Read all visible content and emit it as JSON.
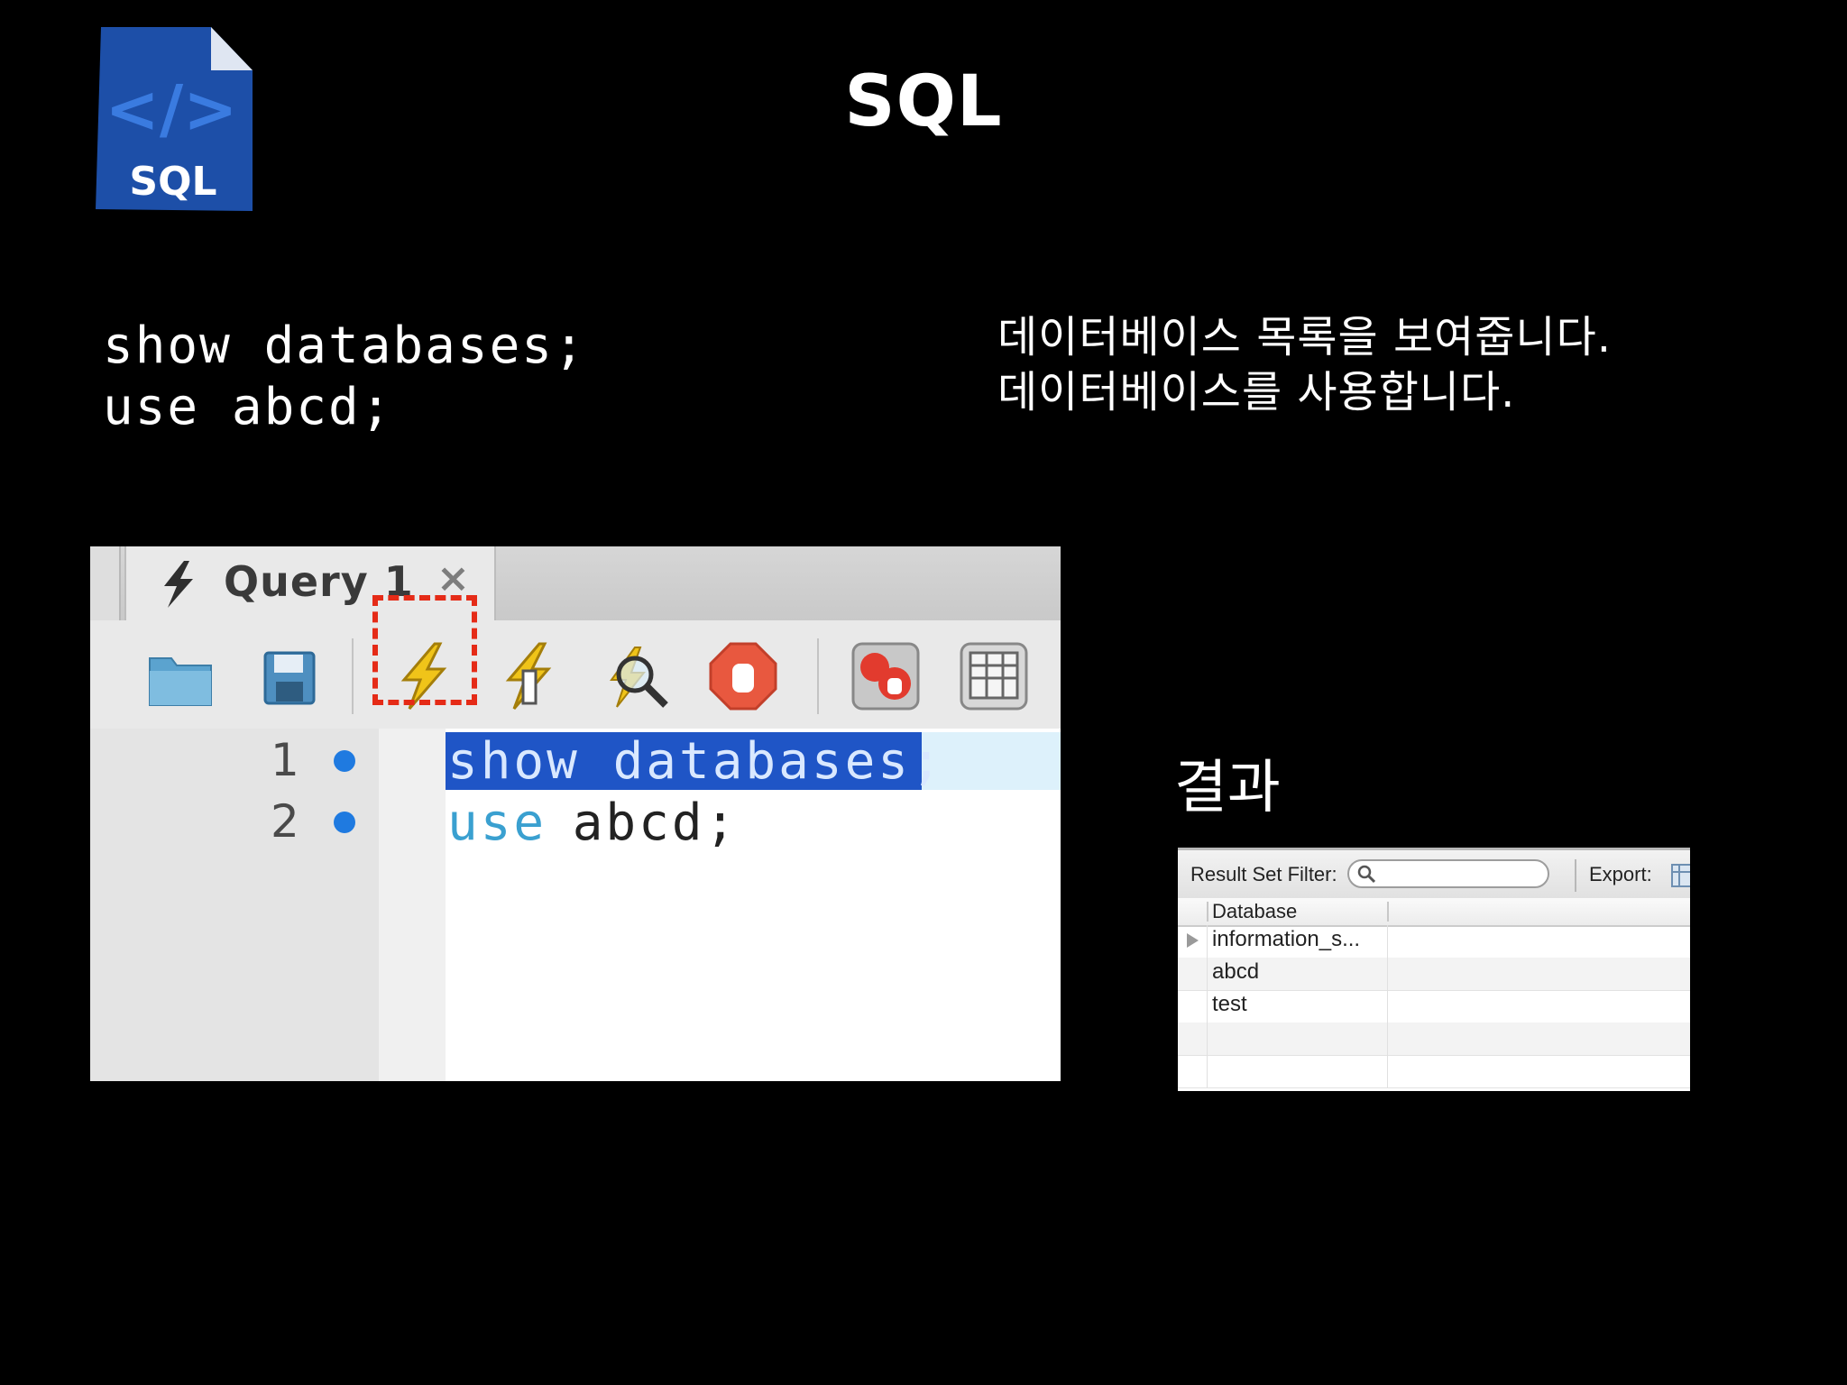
{
  "slide": {
    "title": "SQL",
    "icon_label": "SQL",
    "icon_brackets": "</>"
  },
  "code_lines": [
    "show databases;",
    "use abcd;"
  ],
  "descriptions": [
    "데이터베이스 목록을 보여줍니다.",
    "데이터베이스를 사용합니다."
  ],
  "editor": {
    "tab_label": "Query 1",
    "tab_close": "×",
    "toolbar": [
      "open-folder-icon",
      "save-icon",
      "execute-all-icon",
      "execute-current-icon",
      "explain-icon",
      "stop-icon",
      "toggle-error-icon",
      "result-grid-icon"
    ],
    "line_numbers": [
      "1",
      "2"
    ],
    "line1_selected": "show databases;",
    "line2_keyword": "use",
    "line2_rest": " abcd;",
    "highlight_color": "#e52b17",
    "selection_color": "#1f55c6"
  },
  "result_heading": "결과",
  "result": {
    "filter_label": "Result Set Filter:",
    "filter_value": "",
    "export_label": "Export:",
    "column": "Database",
    "rows": [
      "information_s...",
      "abcd",
      "test"
    ]
  }
}
